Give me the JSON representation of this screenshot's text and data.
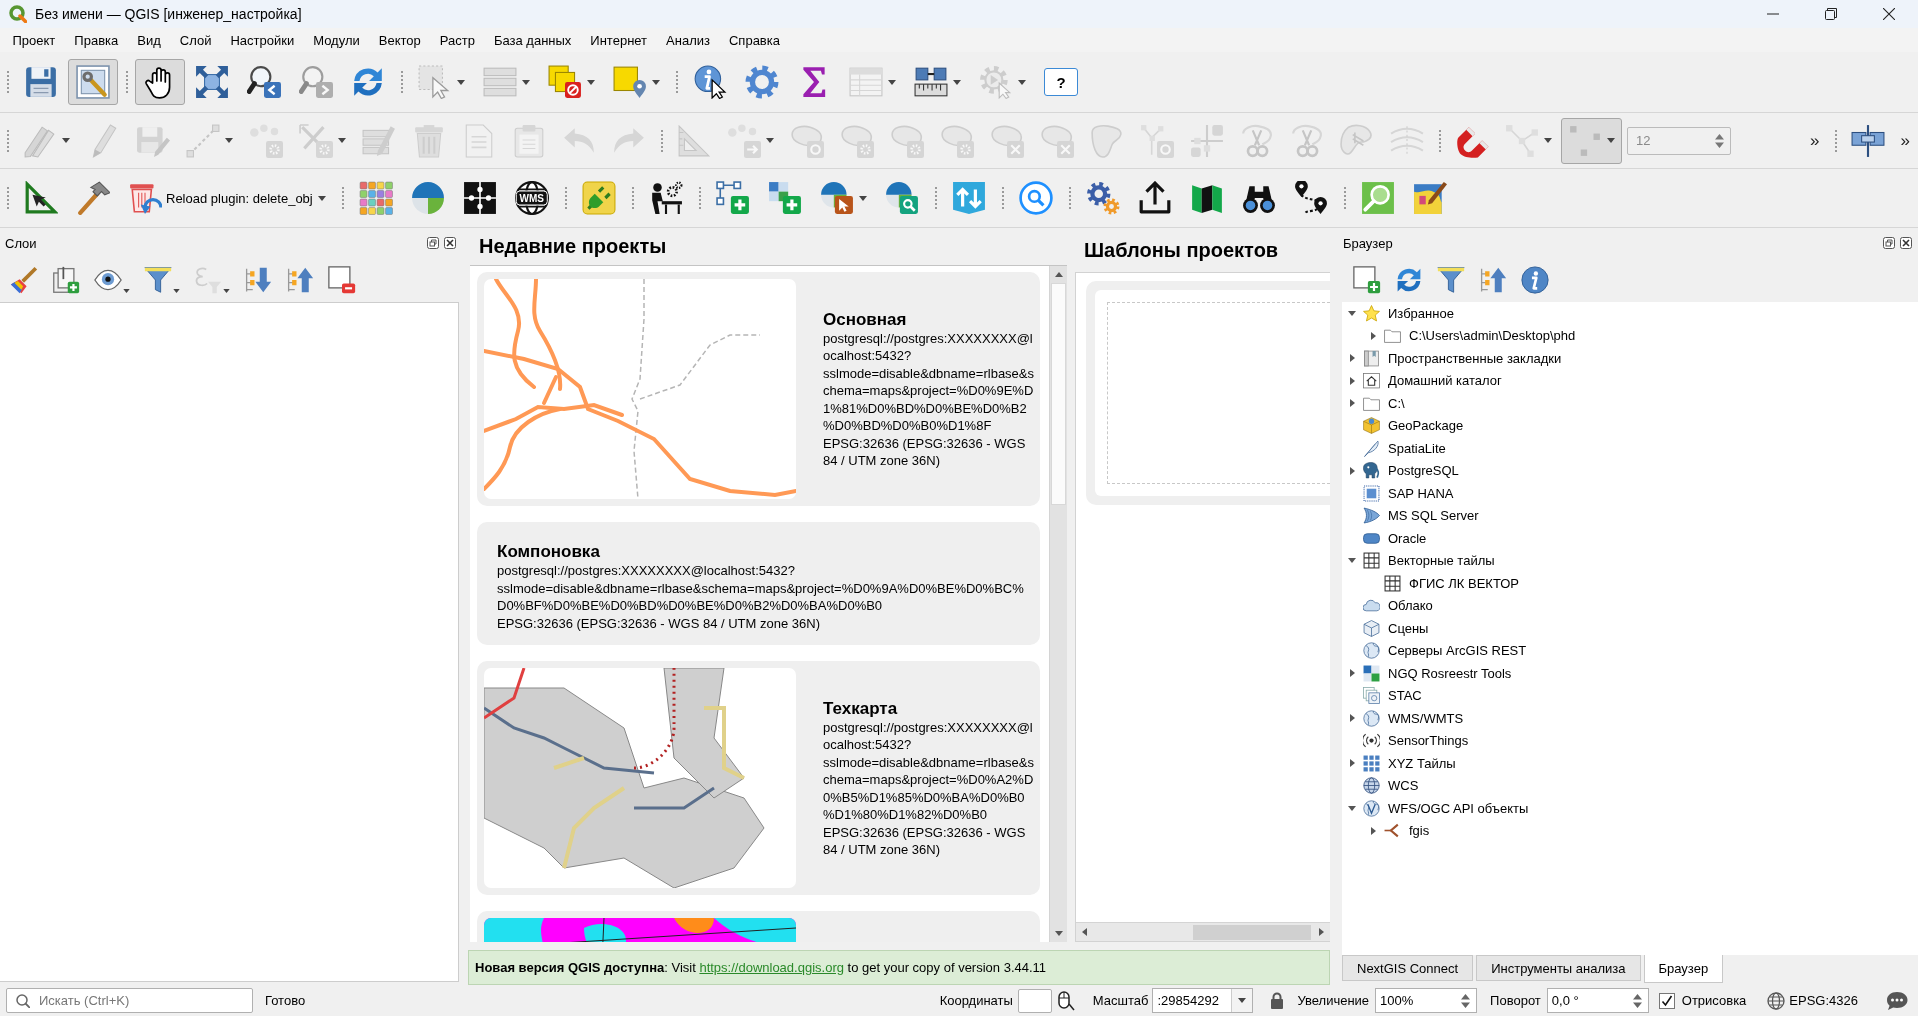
{
  "window": {
    "title": "Без имени — QGIS [инженер_настройка]"
  },
  "menu": [
    "Проект",
    "Правка",
    "Вид",
    "Слой",
    "Настройки",
    "Модули",
    "Вектор",
    "Растр",
    "База данных",
    "Интернет",
    "Анализ",
    "Справка"
  ],
  "toolbar_rows": [
    [
      {
        "items": [
          {
            "kind": "save",
            "disabled": false,
            "checked": false
          },
          {
            "kind": "project-properties",
            "disabled": false,
            "checked": true
          }
        ]
      },
      {
        "items": [
          {
            "kind": "pan",
            "disabled": false,
            "checked": true
          },
          {
            "kind": "zoom-full",
            "disabled": false,
            "checked": false
          },
          {
            "kind": "zoom-last",
            "disabled": false,
            "checked": false
          },
          {
            "kind": "zoom-next",
            "disabled": true,
            "checked": false
          },
          {
            "kind": "refresh",
            "disabled": false,
            "checked": false
          }
        ]
      },
      {
        "items": [
          {
            "kind": "select",
            "disabled": true,
            "checked": false,
            "dropdown": true
          },
          {
            "kind": "select-rows",
            "disabled": true,
            "checked": false,
            "dropdown": true
          },
          {
            "kind": "deselect",
            "disabled": false,
            "checked": false,
            "dropdown": true
          },
          {
            "kind": "select-location",
            "disabled": false,
            "checked": false,
            "dropdown": true
          }
        ]
      },
      {
        "items": [
          {
            "kind": "identify",
            "disabled": false,
            "checked": false
          },
          {
            "kind": "processing",
            "disabled": false,
            "checked": false
          },
          {
            "kind": "statistics",
            "disabled": false,
            "checked": false
          },
          {
            "kind": "attribute-table",
            "disabled": true,
            "checked": false,
            "dropdown": true
          },
          {
            "kind": "measure",
            "disabled": false,
            "checked": false,
            "dropdown": true
          },
          {
            "kind": "action",
            "disabled": true,
            "checked": false,
            "dropdown": true
          },
          {
            "kind": "help",
            "label": "?",
            "disabled": false
          }
        ]
      }
    ],
    [
      {
        "items": [
          {
            "kind": "edit-toggle",
            "disabled": true,
            "checked": false,
            "dropdown": true
          },
          {
            "kind": "pencil",
            "disabled": true,
            "checked": false
          },
          {
            "kind": "save-edits",
            "disabled": true,
            "checked": false
          },
          {
            "kind": "add-line",
            "disabled": true,
            "checked": false,
            "dropdown": true
          },
          {
            "kind": "vertex",
            "disabled": true,
            "checked": false
          },
          {
            "kind": "multi-edit",
            "disabled": true,
            "checked": false,
            "dropdown": true
          },
          {
            "kind": "edit-attributes",
            "disabled": true,
            "checked": false
          },
          {
            "kind": "delete",
            "disabled": true,
            "checked": false
          },
          {
            "kind": "copy",
            "disabled": true,
            "checked": false
          },
          {
            "kind": "paste",
            "disabled": true,
            "checked": false
          },
          {
            "kind": "undo",
            "disabled": true,
            "checked": false
          },
          {
            "kind": "redo",
            "disabled": true,
            "checked": false
          }
        ]
      },
      {
        "items": [
          {
            "kind": "set-square",
            "disabled": true,
            "checked": false
          },
          {
            "kind": "move",
            "disabled": true,
            "checked": false,
            "dropdown": true
          },
          {
            "kind": "rotate",
            "disabled": true,
            "checked": false
          },
          {
            "kind": "simplify",
            "disabled": true,
            "checked": false
          },
          {
            "kind": "add-ring",
            "disabled": true,
            "checked": false
          },
          {
            "kind": "add-part",
            "disabled": true,
            "checked": false
          },
          {
            "kind": "delete-ring",
            "disabled": true,
            "checked": false
          },
          {
            "kind": "delete-part",
            "disabled": true,
            "checked": false
          },
          {
            "kind": "fill-ring",
            "disabled": true,
            "checked": false
          },
          {
            "kind": "reverse-line",
            "disabled": true,
            "checked": false
          },
          {
            "kind": "split-parts",
            "disabled": true,
            "checked": false
          },
          {
            "kind": "split-features",
            "disabled": true,
            "checked": false
          },
          {
            "kind": "split-shapes",
            "disabled": true,
            "checked": false
          },
          {
            "kind": "reshape",
            "disabled": true,
            "checked": false
          },
          {
            "kind": "offset",
            "disabled": true,
            "checked": false
          }
        ]
      },
      {
        "items": [
          {
            "kind": "snapping",
            "disabled": false,
            "checked": false
          },
          {
            "kind": "snap-vertex",
            "disabled": true,
            "checked": false,
            "dropdown": true
          },
          {
            "kind": "snap-grid",
            "disabled": true,
            "checked": true,
            "dropdown": true
          },
          {
            "kind": "spinbox",
            "value": "12",
            "disabled": true
          },
          {
            "kind": "more",
            "label": "»",
            "disabled": false
          }
        ]
      },
      {
        "items": [
          {
            "kind": "panels",
            "disabled": false,
            "checked": false
          },
          {
            "kind": "more",
            "label": "»",
            "disabled": false
          }
        ]
      }
    ],
    [
      {
        "items": [
          {
            "kind": "digitize",
            "disabled": false,
            "checked": false
          },
          {
            "kind": "plugin-builder",
            "disabled": false,
            "checked": false
          },
          {
            "kind": "reload-plugin",
            "label": "Reload plugin: delete_obj",
            "disabled": false,
            "checked": false,
            "dropdown": true
          }
        ]
      },
      {
        "items": [
          {
            "kind": "color-grid",
            "disabled": false,
            "checked": false
          },
          {
            "kind": "pie-chart",
            "disabled": false,
            "checked": false
          },
          {
            "kind": "puzzle",
            "disabled": false,
            "checked": false
          },
          {
            "kind": "wms",
            "label": "WMS",
            "disabled": false,
            "checked": false
          }
        ]
      },
      {
        "items": [
          {
            "kind": "plugin",
            "disabled": false,
            "checked": false
          }
        ]
      },
      {
        "items": [
          {
            "kind": "workplace",
            "disabled": false,
            "checked": false
          }
        ]
      },
      {
        "items": [
          {
            "kind": "add-node",
            "disabled": false,
            "checked": false
          },
          {
            "kind": "grid-plus",
            "disabled": false,
            "checked": false
          },
          {
            "kind": "pie-cursor",
            "disabled": false,
            "checked": false,
            "dropdown": true
          },
          {
            "kind": "pie-search",
            "disabled": false,
            "checked": false
          }
        ]
      },
      {
        "items": [
          {
            "kind": "updown",
            "disabled": false,
            "checked": false
          }
        ]
      },
      {
        "items": [
          {
            "kind": "search",
            "disabled": false,
            "checked": false
          }
        ]
      },
      {
        "items": [
          {
            "kind": "gears",
            "disabled": false,
            "checked": false
          },
          {
            "kind": "upload",
            "disabled": false,
            "checked": false
          },
          {
            "kind": "map",
            "disabled": false,
            "checked": false
          },
          {
            "kind": "binoculars",
            "disabled": false,
            "checked": false
          },
          {
            "kind": "route",
            "disabled": false,
            "checked": false
          }
        ]
      },
      {
        "items": [
          {
            "kind": "magnifier-tile",
            "disabled": false,
            "checked": false
          },
          {
            "kind": "map-pen",
            "disabled": false,
            "checked": false
          }
        ]
      }
    ]
  ],
  "layers_panel": {
    "title": "Слои",
    "toolbar": [
      {
        "kind": "style",
        "disabled": false
      },
      {
        "kind": "add-group",
        "disabled": false
      },
      {
        "kind": "visibility",
        "disabled": false,
        "dropdown": true
      },
      {
        "kind": "filter",
        "disabled": false,
        "dropdown": true
      },
      {
        "kind": "expression-filter",
        "disabled": true,
        "dropdown": true
      },
      {
        "kind": "expand-all",
        "disabled": false
      },
      {
        "kind": "collapse-all",
        "disabled": false
      },
      {
        "kind": "remove-layer",
        "disabled": false
      }
    ]
  },
  "recent_projects": {
    "heading": "Недавние проекты",
    "projects": [
      {
        "kind": "roads-map",
        "title": "Основная",
        "uri": "postgresql://postgres:XXXXXXXX@localhost:5432?sslmode=disable&dbname=rlbase&schema=maps&project=%D0%9E%D1%81%D0%BD%D0%BE%D0%B2%D0%BD%D0%B0%D1%8F",
        "crs": "EPSG:32636 (EPSG:32636 - WGS 84 / UTM zone 36N)"
      },
      {
        "kind": "no-preview",
        "title": "Компоновка",
        "uri": "postgresql://postgres:XXXXXXXX@localhost:5432?sslmode=disable&dbname=rlbase&schema=maps&project=%D0%9A%D0%BE%D0%BC%D0%BF%D0%BE%D0%BD%D0%BE%D0%B2%D0%BA%D0%B0",
        "crs": "EPSG:32636 (EPSG:32636 - WGS 84 / UTM zone 36N)"
      },
      {
        "kind": "parcels-map",
        "title": "Техкарта",
        "uri": "postgresql://postgres:XXXXXXXX@localhost:5432?sslmode=disable&dbname=rlbase&schema=maps&project=%D0%A2%D0%B5%D1%85%D0%BA%D0%B0%D1%80%D1%82%D0%B0",
        "crs": "EPSG:32636 (EPSG:32636 - WGS 84 / UTM zone 36N)"
      },
      {
        "kind": "landuse-map"
      }
    ]
  },
  "project_templates": {
    "heading": "Шаблоны проектов"
  },
  "update_notice": {
    "text": "**Новая версия QGIS доступна**: Visit",
    "link": "https://download.qgis.org",
    "tail": "to get your copy of version 3.44.11"
  },
  "browser_panel": {
    "title": "Браузер",
    "toolbar": [
      {
        "kind": "add-layer",
        "disabled": false
      },
      {
        "kind": "refresh",
        "disabled": false
      },
      {
        "kind": "filter",
        "disabled": false
      },
      {
        "kind": "collapse-all",
        "disabled": false
      },
      {
        "kind": "properties",
        "disabled": false
      }
    ],
    "tree": [
      {
        "kind": "favorites",
        "label": "Избранное",
        "expanded": true,
        "children": [
          {
            "kind": "folder",
            "label": "C:\\Users\\admin\\Desktop\\phd",
            "expanded": false
          }
        ]
      },
      {
        "kind": "bookmarks",
        "label": "Пространственные закладки",
        "expanded": false
      },
      {
        "kind": "home",
        "label": "Домашний каталог",
        "expanded": false
      },
      {
        "kind": "folder",
        "label": "C:\\",
        "expanded": false
      },
      {
        "kind": "geopackage",
        "label": "GeoPackage"
      },
      {
        "kind": "spatialite",
        "label": "SpatiaLite"
      },
      {
        "kind": "postgresql",
        "label": "PostgreSQL",
        "expanded": false
      },
      {
        "kind": "saphana",
        "label": "SAP HANA"
      },
      {
        "kind": "mssql",
        "label": "MS SQL Server"
      },
      {
        "kind": "oracle",
        "label": "Oracle"
      },
      {
        "kind": "vector-tiles",
        "label": "Векторные тайлы",
        "expanded": true,
        "children": [
          {
            "kind": "vector-tiles",
            "label": "ФГИС ЛК ВЕКТОР"
          }
        ]
      },
      {
        "kind": "cloud",
        "label": "Облако"
      },
      {
        "kind": "scenes",
        "label": "Сцены"
      },
      {
        "kind": "arcgis",
        "label": "Серверы ArcGIS REST"
      },
      {
        "kind": "ngq",
        "label": "NGQ Rosreestr Tools",
        "expanded": false
      },
      {
        "kind": "stac",
        "label": "STAC"
      },
      {
        "kind": "wms",
        "label": "WMS/WMTS",
        "expanded": false
      },
      {
        "kind": "sensorthings",
        "label": "SensorThings"
      },
      {
        "kind": "xyz",
        "label": "XYZ Тайлы",
        "expanded": false
      },
      {
        "kind": "wcs",
        "label": "WCS"
      },
      {
        "kind": "wfs",
        "label": "WFS/OGC API объекты",
        "expanded": true,
        "children": [
          {
            "kind": "connection",
            "label": "fgis",
            "expanded": false
          }
        ]
      }
    ],
    "tabs": [
      {
        "label": "NextGIS Connect",
        "selected": false
      },
      {
        "label": "Инструменты анализа",
        "selected": false
      },
      {
        "label": "Браузер",
        "selected": true
      }
    ]
  },
  "status_bar": {
    "search": {
      "placeholder": "Искать (Ctrl+K)"
    },
    "message": "Готово",
    "coordinate": {
      "label": "Координаты"
    },
    "scale": {
      "label": "Масштаб",
      "value": ":29854292"
    },
    "magnifier": {
      "label": "Увеличение",
      "value": "100%"
    },
    "rotation": {
      "label": "Поворот",
      "value": "0,0 °"
    },
    "render": {
      "label": "Отрисовка",
      "checked": true
    },
    "crs": "EPSG:4326"
  }
}
